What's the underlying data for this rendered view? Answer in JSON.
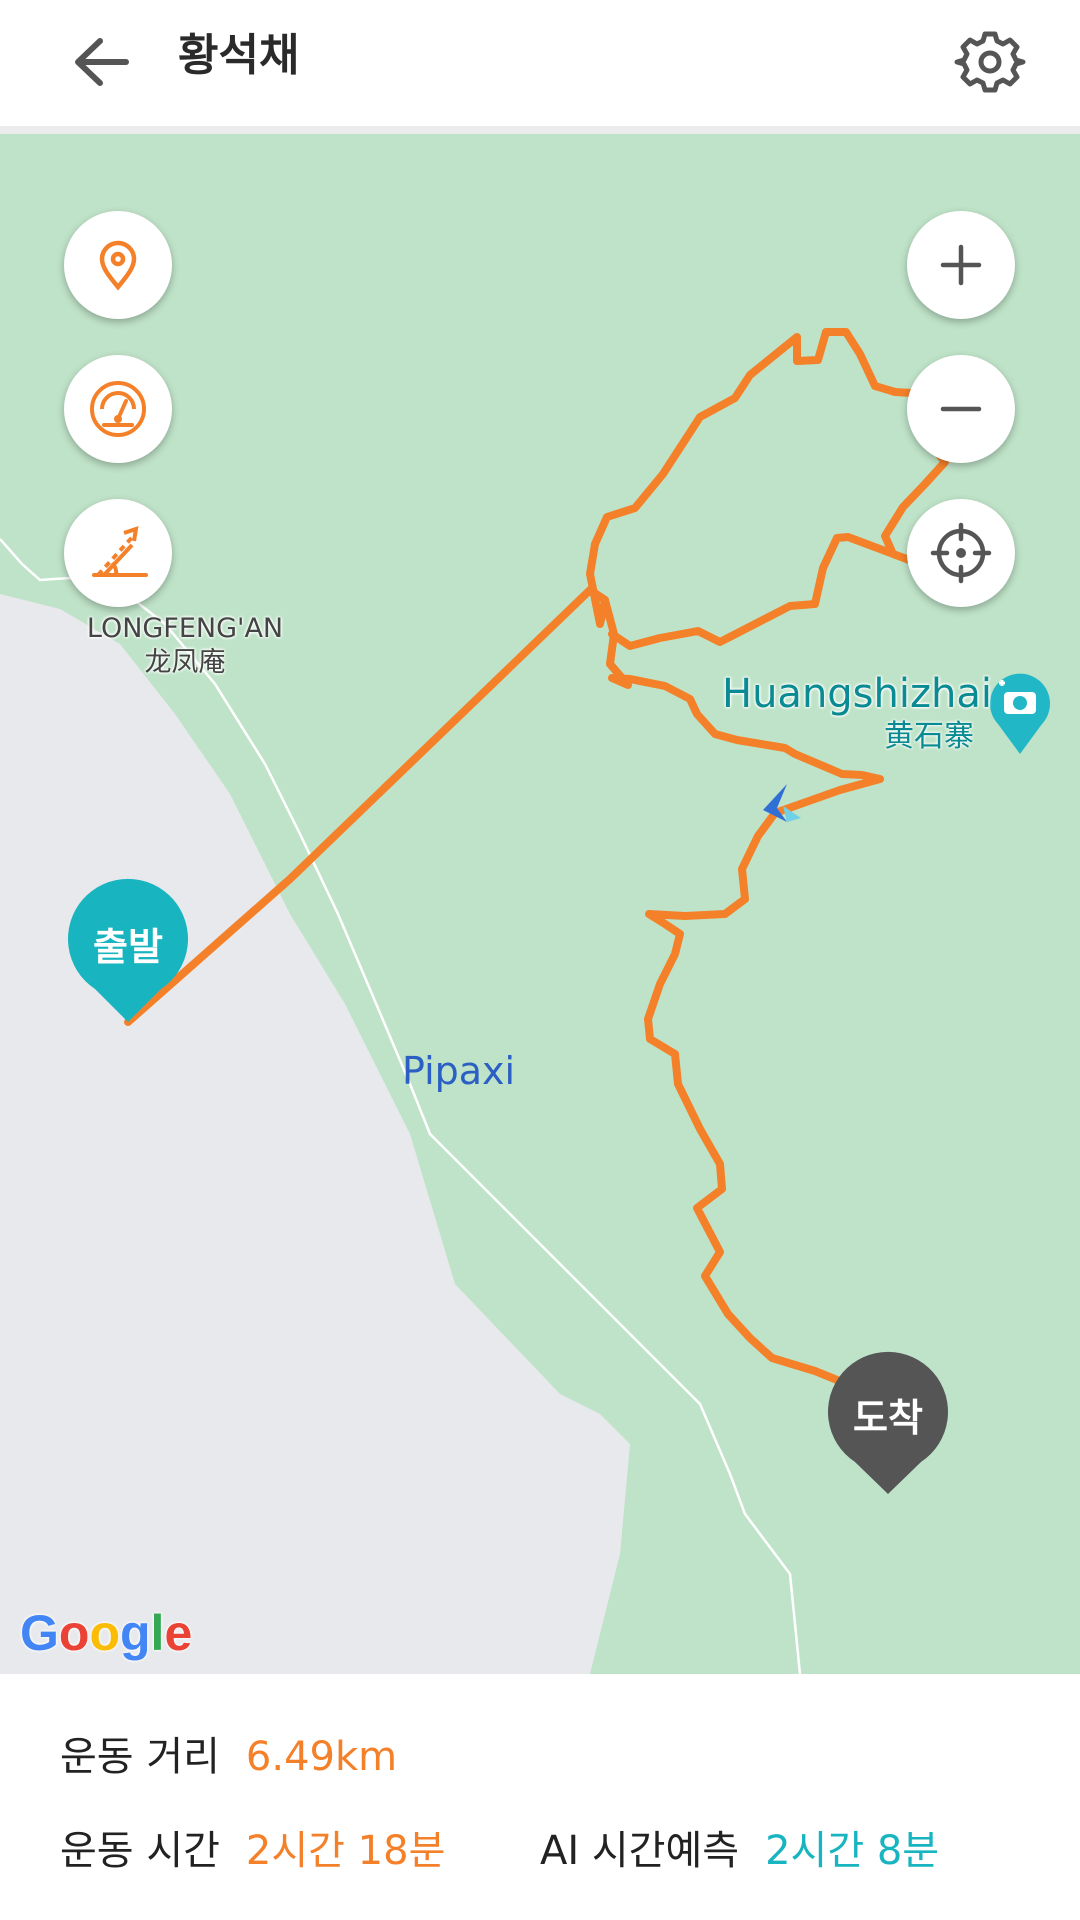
{
  "header": {
    "title": "황석채",
    "back_icon": "arrow-left-icon",
    "settings_icon": "gear-icon"
  },
  "map": {
    "labels": {
      "area_en": "LONGFENG'AN",
      "area_cn": "龙凤庵",
      "poi_en": "Huangshizhai",
      "poi_cn": "黄石寨",
      "river": "Pipaxi"
    },
    "start_marker": "출발",
    "end_marker": "도착",
    "attribution": "Google",
    "controls": {
      "left": [
        "location-pin-icon",
        "speedometer-icon",
        "slope-icon"
      ],
      "right": [
        "zoom-in-icon",
        "zoom-out-icon",
        "crosshair-icon"
      ]
    },
    "colors": {
      "route": "#f4812a",
      "park": "#bfe3c8",
      "land": "#e8e9ec",
      "start_marker": "#18b5c0",
      "end_marker": "#555555"
    }
  },
  "stats": {
    "distance_label": "운동 거리",
    "distance_value": "6.49km",
    "time_label": "운동 시간",
    "time_value": "2시간 18분",
    "ai_label": "AI 시간예측",
    "ai_value": "2시간 8분"
  }
}
